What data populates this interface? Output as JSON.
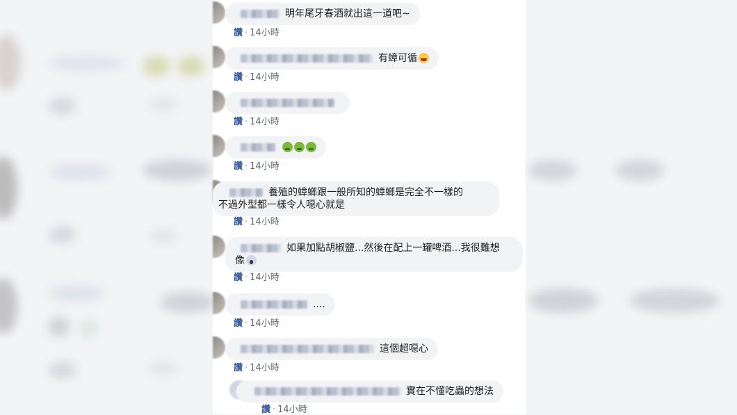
{
  "comments": [
    {
      "text": "明年尾牙春酒就出這一道吧~",
      "like": "讚",
      "time": "14小時",
      "emojis": []
    },
    {
      "text": "有蟑可循",
      "like": "讚",
      "time": "14小時",
      "emojis": [
        "laughing-emoji"
      ]
    },
    {
      "text": "",
      "like": "讚",
      "time": "14小時",
      "emojis": []
    },
    {
      "text": "",
      "like": "讚",
      "time": "14小時",
      "emojis": [
        "nauseated-emoji",
        "nauseated-emoji",
        "nauseated-emoji"
      ]
    },
    {
      "text_line1": "養殖的蟑螂跟一般所知的蟑螂是完全不一樣的",
      "text_line2": "不過外型都一樣令人噁心就是",
      "like": "讚",
      "time": "14小時"
    },
    {
      "text_line1": "如果加點胡椒鹽...然後在配上一罐啤酒...我很難想",
      "text_line2": "像",
      "like": "讚",
      "time": "14小時",
      "emojis": [
        "screaming-emoji"
      ]
    },
    {
      "text": "....",
      "like": "讚",
      "time": "14小時"
    },
    {
      "text": "這個超噁心",
      "like": "讚",
      "time": "14小時"
    },
    {
      "text": "實在不懂吃蟲的想法",
      "like": "讚",
      "time": "14小時"
    }
  ],
  "colors": {
    "bubble": "#f2f3f5",
    "link": "#365899",
    "background": "#f3f4f6"
  }
}
